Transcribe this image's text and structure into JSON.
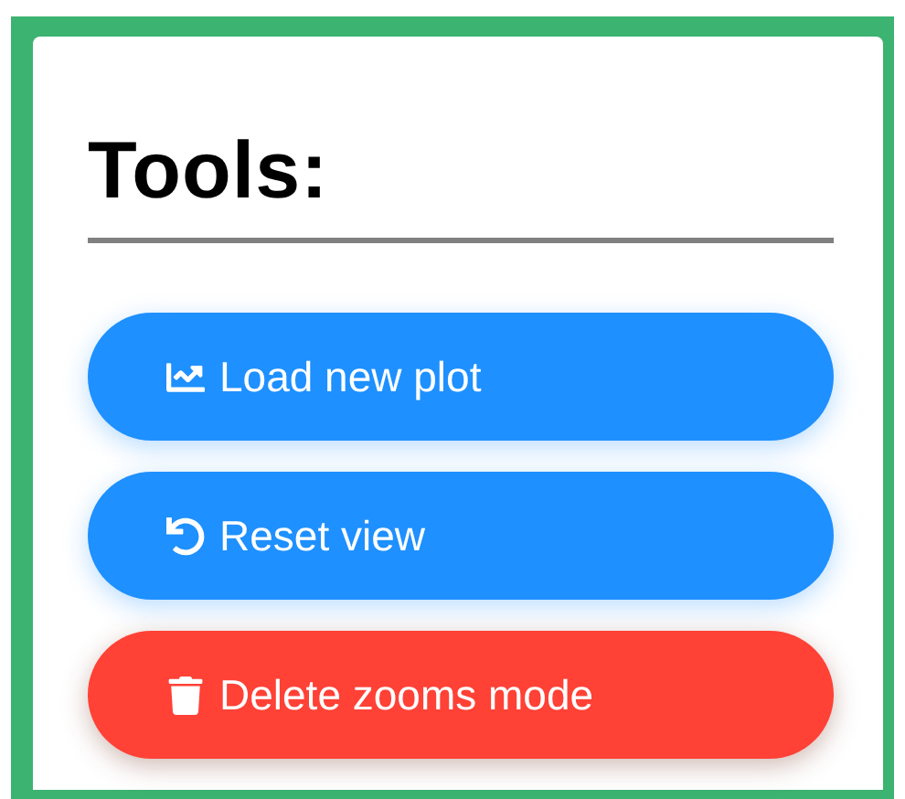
{
  "panel": {
    "title": "Tools:"
  },
  "buttons": [
    {
      "label": "Load new plot",
      "kind": "primary"
    },
    {
      "label": "Reset view",
      "kind": "primary"
    },
    {
      "label": "Delete zooms mode",
      "kind": "danger"
    }
  ]
}
